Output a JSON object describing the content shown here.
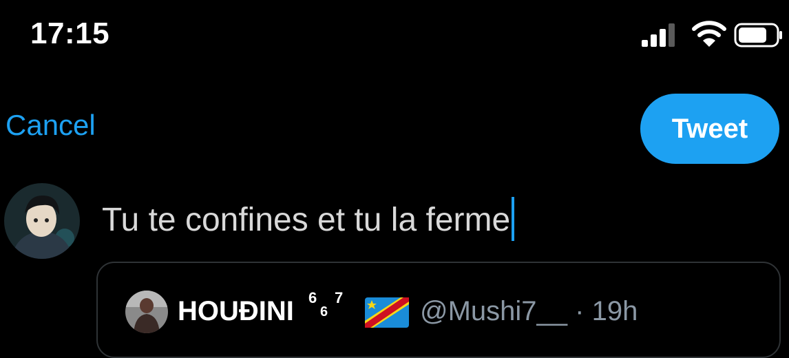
{
  "status_bar": {
    "time": "17:15",
    "icons": [
      "signal-icon",
      "wifi-icon",
      "battery-icon"
    ]
  },
  "compose": {
    "cancel_label": "Cancel",
    "tweet_label": "Tweet",
    "text": "Tu te confines et tu la ferme"
  },
  "quoted_tweet": {
    "display_name": "HOUĐINI",
    "name_badge_sup": "6",
    "name_badge_sub": "6",
    "name_badge_sup2": "7",
    "flag": "DR Congo flag",
    "handle_time": "@Mushi7__ · 19h"
  },
  "colors": {
    "accent": "#1da1f2",
    "background": "#000000",
    "secondary_text": "#8b98a5",
    "border": "#2f3336"
  }
}
